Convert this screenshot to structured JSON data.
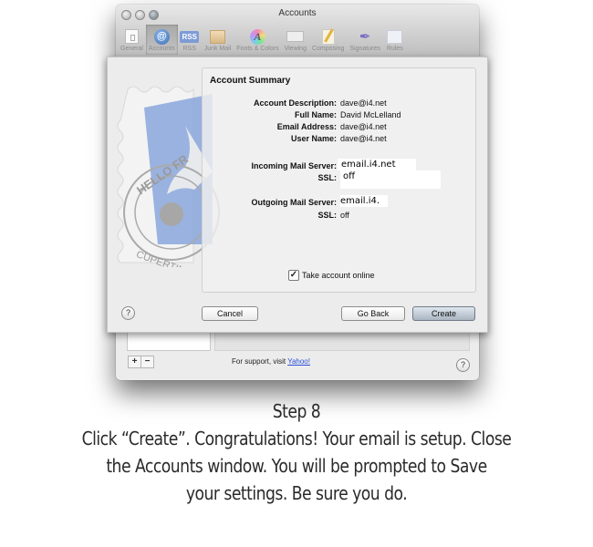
{
  "window": {
    "title": "Accounts",
    "toolbar": [
      {
        "label": "General",
        "icon": "general-switch-icon",
        "selected": false
      },
      {
        "label": "Accounts",
        "icon": "at-sign-icon",
        "selected": true
      },
      {
        "label": "RSS",
        "icon": "rss-icon",
        "selected": false
      },
      {
        "label": "Junk Mail",
        "icon": "junk-mail-icon",
        "selected": false
      },
      {
        "label": "Fonts & Colors",
        "icon": "fonts-colors-icon",
        "selected": false
      },
      {
        "label": "Viewing",
        "icon": "viewing-icon",
        "selected": false
      },
      {
        "label": "Composing",
        "icon": "composing-icon",
        "selected": false
      },
      {
        "label": "Signatures",
        "icon": "signatures-icon",
        "selected": false
      },
      {
        "label": "Rules",
        "icon": "rules-icon",
        "selected": false
      }
    ],
    "background": {
      "add_label": "+",
      "remove_label": "−",
      "support_text": "For support, visit ",
      "support_link": "Yahoo!",
      "help_label": "?"
    }
  },
  "sheet": {
    "summary_title": "Account Summary",
    "fields": [
      {
        "label": "Account Description:",
        "value": "dave@i4.net"
      },
      {
        "label": "Full Name:",
        "value": "David McLelland"
      },
      {
        "label": "Email Address:",
        "value": "dave@i4.net"
      },
      {
        "label": "User Name:",
        "value": "dave@i4.net"
      }
    ],
    "incoming": {
      "label": "Incoming Mail Server:",
      "value": "email.i4.net",
      "ssl_label": "SSL:",
      "ssl_value": "off"
    },
    "outgoing": {
      "label": "Outgoing Mail Server:",
      "value": "email.i4.",
      "ssl_label": "SSL:",
      "ssl_value": "off"
    },
    "take_online": {
      "label": "Take account online",
      "checked": true,
      "check_glyph": "✓"
    },
    "buttons": {
      "help": "?",
      "cancel": "Cancel",
      "go_back": "Go Back",
      "create": "Create"
    }
  },
  "caption": {
    "heading": "Step 8",
    "lines": [
      "Click “Create”.  Congratulations!  Your email is setup.  Close",
      "the Accounts window.  You will be prompted to Save",
      "your settings.  Be sure you do."
    ]
  },
  "colors": {
    "link": "#2a4fd8",
    "default_button": "#aab5c2",
    "stamp_blue": "#7f9fd8"
  }
}
